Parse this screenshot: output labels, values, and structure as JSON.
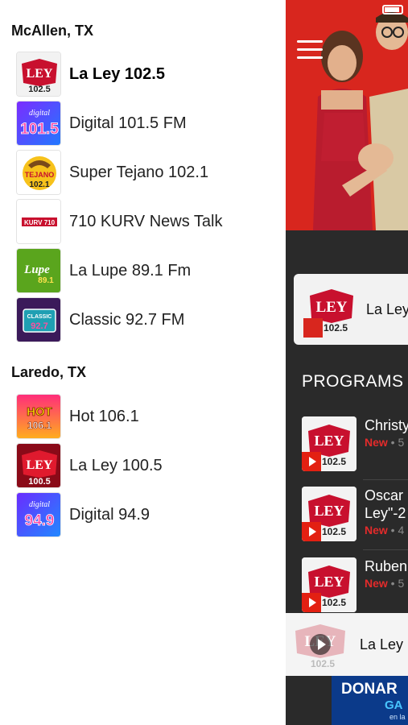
{
  "drawer": {
    "sections": [
      {
        "title": "McAllen, TX",
        "stations": [
          {
            "name": "La Ley 102.5",
            "logo": "la-ley-1025-logo",
            "active": true
          },
          {
            "name": "Digital 101.5 FM",
            "logo": "digital-1015-logo"
          },
          {
            "name": "Super Tejano 102.1",
            "logo": "super-tejano-1021-logo"
          },
          {
            "name": "710 KURV News Talk",
            "logo": "kurv-710-logo"
          },
          {
            "name": "La Lupe 89.1 Fm",
            "logo": "la-lupe-891-logo"
          },
          {
            "name": "Classic 92.7 FM",
            "logo": "classic-927-logo"
          }
        ]
      },
      {
        "title": "Laredo, TX",
        "stations": [
          {
            "name": "Hot 106.1",
            "logo": "hot-1061-logo"
          },
          {
            "name": "La Ley 100.5",
            "logo": "la-ley-1005-logo"
          },
          {
            "name": "Digital 94.9",
            "logo": "digital-949-logo"
          }
        ]
      }
    ],
    "logo_text": {
      "ley": "LEY",
      "ley_1025": "102.5",
      "ley_1005": "100.5",
      "digital": "digital",
      "digital_1015": "101.5",
      "digital_949": "94.9",
      "tejano": "TEJANO",
      "tejano_num": "102.1",
      "kurv": "KURV 710",
      "lupe": "Lupe",
      "lupe_num": "89.1",
      "classic": "CLASSIC",
      "classic_num": "92.7",
      "hot": "HOT",
      "hot_num": "106.1"
    }
  },
  "app": {
    "current_station_card": "La Ley",
    "programs_title": "PROGRAMS",
    "programs": [
      {
        "title": "Christy",
        "new": "New",
        "meta": " • 5"
      },
      {
        "title": "Oscar",
        "title2": "Ley\"-2",
        "new": "New",
        "meta": " • 4"
      },
      {
        "title": "Ruben",
        "new": "New",
        "meta": " • 5"
      }
    ],
    "player_label": "La Ley",
    "banner": {
      "line1": "DONAR",
      "line2": "GA",
      "line3": "en la"
    }
  },
  "colors": {
    "accent_red": "#d8261e",
    "new_red": "#e32b2b",
    "panel_dark": "#2a2a2a",
    "banner_blue": "#0b3a8a"
  }
}
